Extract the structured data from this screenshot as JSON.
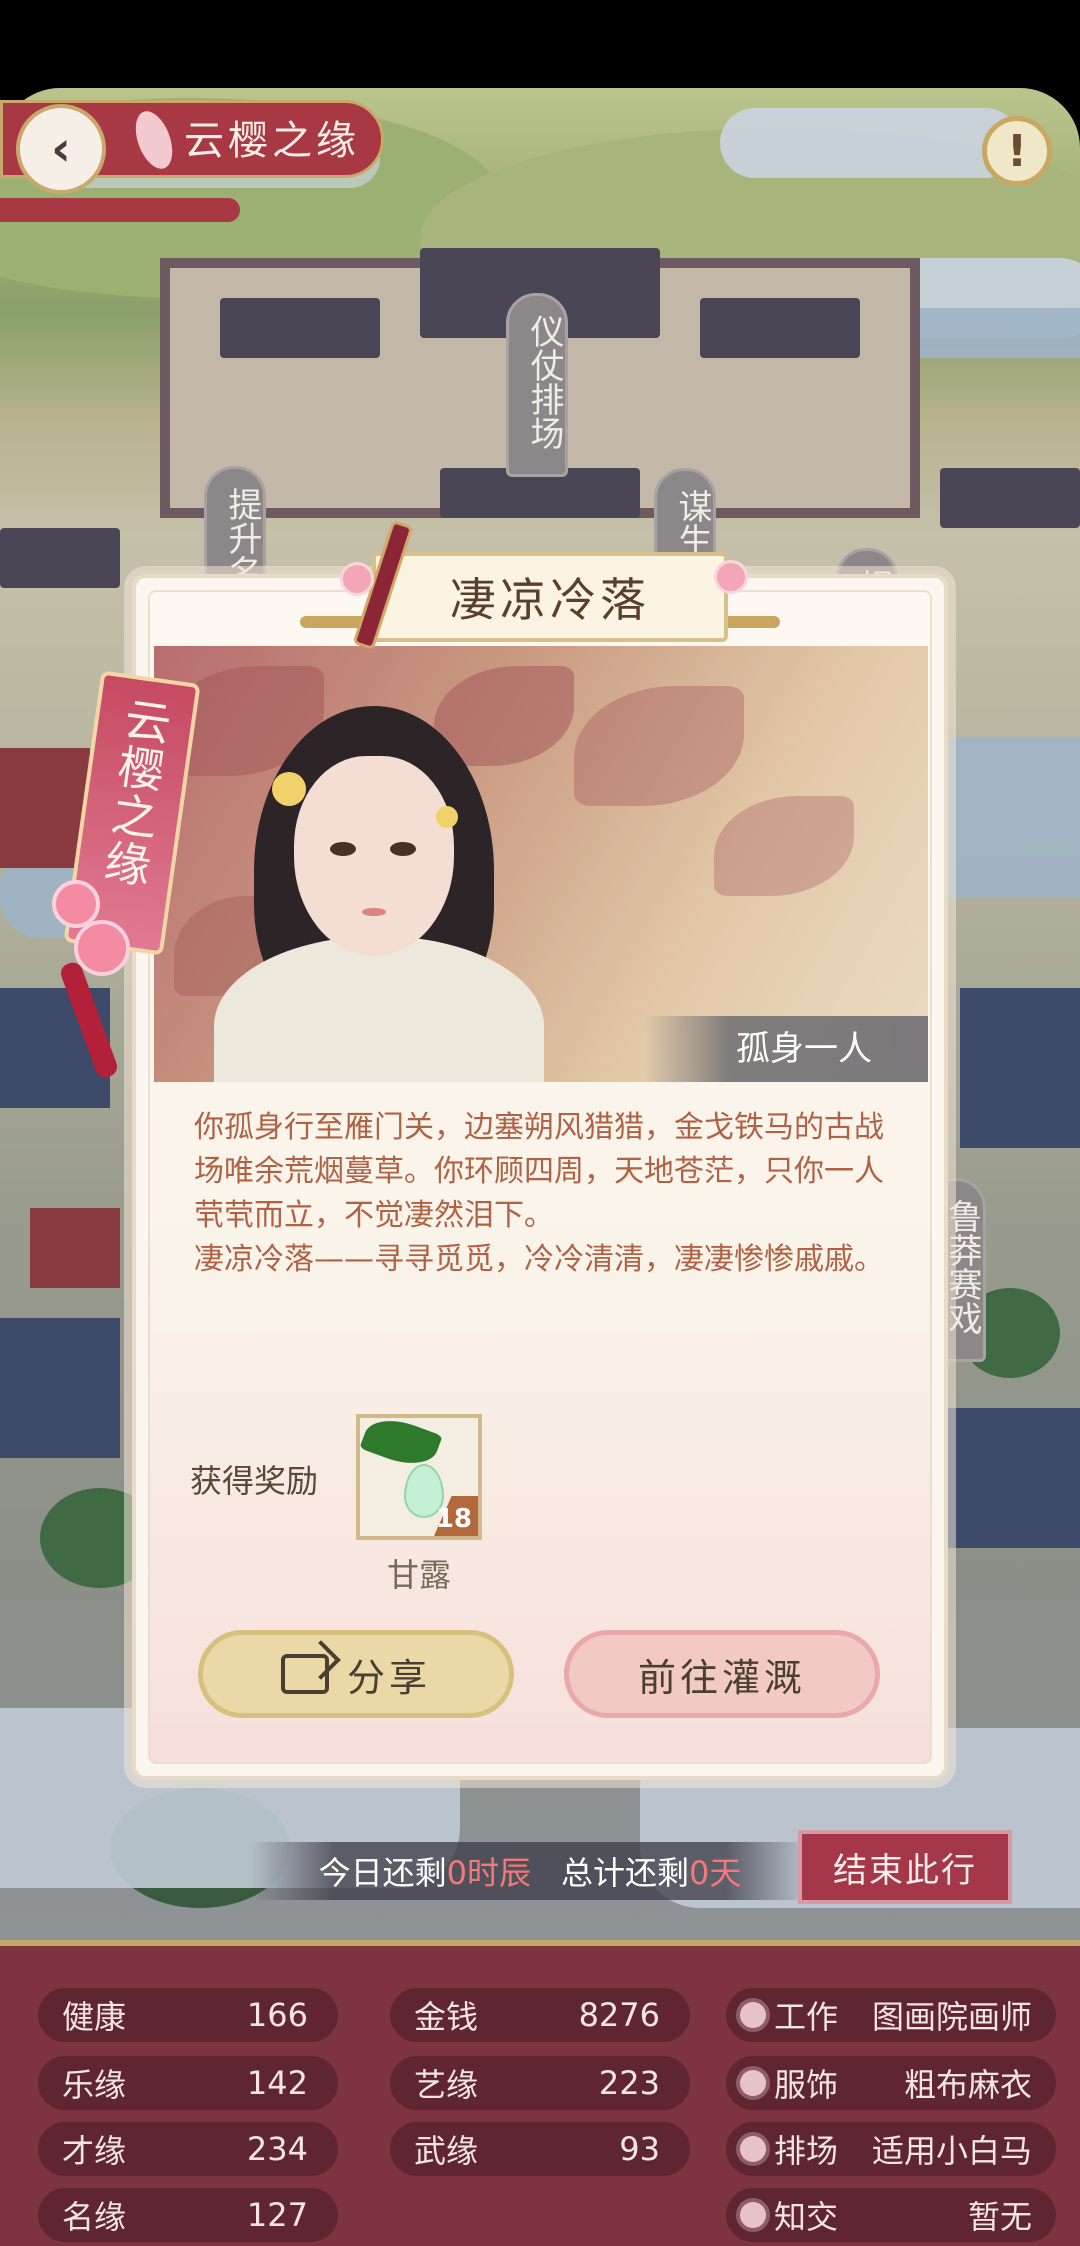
{
  "header": {
    "banner_title": "云樱之缘",
    "back_icon": "chevron-left-icon",
    "info_icon": "exclamation-icon"
  },
  "map": {
    "tags": [
      "仪仗排场",
      "提升名",
      "谋生",
      "提",
      "鲁莽赛戏"
    ]
  },
  "dialog": {
    "title": "凄凉冷落",
    "ribbon_text": "云樱之缘",
    "scene_caption": "孤身一人",
    "story": [
      "你孤身行至雁门关，边塞朔风猎猎，金戈铁马的古战场唯余荒烟蔓草。你环顾四周，天地苍茫，只你一人茕茕而立，不觉凄然泪下。",
      "凄凉冷落——寻寻觅觅，冷冷清清，凄凄惨惨戚戚。"
    ],
    "reward_label": "获得奖励",
    "reward": {
      "name": "甘露",
      "count": "18",
      "icon": "dew-drop-leaf-icon"
    },
    "share_label": "分享",
    "go_label": "前往灌溉"
  },
  "time": {
    "today_prefix": "今日还剩",
    "today_value": "0时辰",
    "total_prefix": "总计还剩",
    "total_value": "0天",
    "end_label": "结束此行"
  },
  "stats": {
    "left": [
      {
        "label": "健康",
        "value": "166"
      },
      {
        "label": "乐缘",
        "value": "142"
      },
      {
        "label": "才缘",
        "value": "234"
      },
      {
        "label": "名缘",
        "value": "127"
      }
    ],
    "middle": [
      {
        "label": "金钱",
        "value": "8276"
      },
      {
        "label": "艺缘",
        "value": "223"
      },
      {
        "label": "武缘",
        "value": "93"
      }
    ],
    "right": [
      {
        "label": "工作",
        "value": "图画院画师"
      },
      {
        "label": "服饰",
        "value": "粗布麻衣"
      },
      {
        "label": "排场",
        "value": "适用小白马"
      },
      {
        "label": "知交",
        "value": "暂无"
      }
    ]
  },
  "colors": {
    "accent_red": "#a93845",
    "gold": "#c9a96a",
    "story_text": "#b06245",
    "highlight": "#f07a7a"
  }
}
